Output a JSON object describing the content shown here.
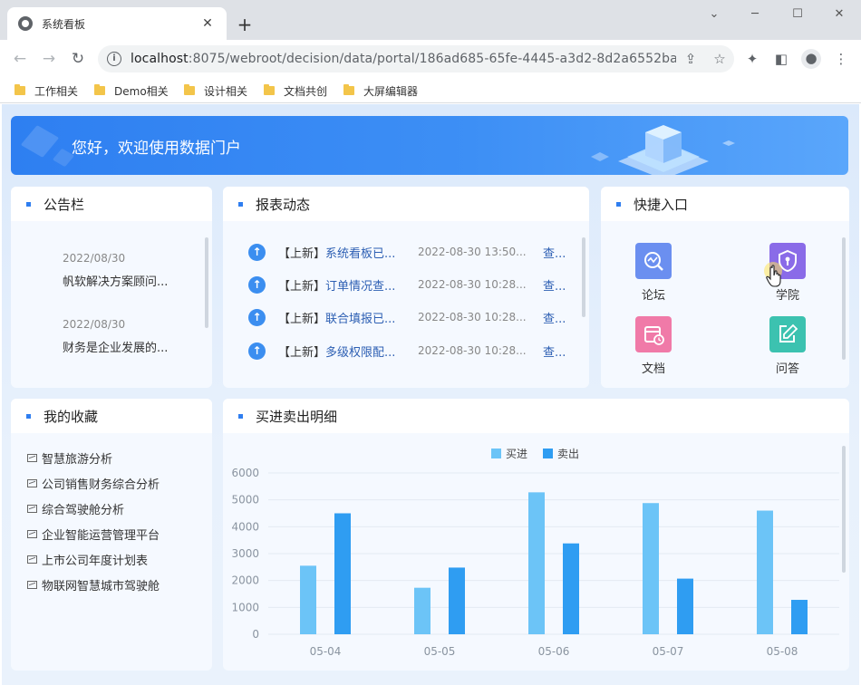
{
  "browser": {
    "tab_title": "系统看板",
    "tab_close": "✕",
    "new_tab": "+",
    "url_host": "localhost",
    "url_rest": ":8075/webroot/decision/data/portal/186ad685-65fe-4445-a3d2-8d2a6552ba2…",
    "window_controls": {
      "minimize": "─",
      "maximize": "☐",
      "close": "✕",
      "tab_search": "⌄"
    },
    "bookmarks": [
      "工作相关",
      "Demo相关",
      "设计相关",
      "文档共创",
      "大屏编辑器"
    ]
  },
  "banner": {
    "greeting": "您好，欢迎使用数据门户"
  },
  "notice": {
    "title": "公告栏",
    "items": [
      {
        "date": "2022/08/30",
        "text": "帆软解决方案顾问..."
      },
      {
        "date": "2022/08/30",
        "text": "财务是企业发展的..."
      }
    ]
  },
  "reports": {
    "title": "报表动态",
    "items": [
      {
        "tag": "【上新】",
        "name": "系统看板已...",
        "time": "2022-08-30 13:50...",
        "view": "查..."
      },
      {
        "tag": "【上新】",
        "name": "订单情况查...",
        "time": "2022-08-30 10:28...",
        "view": "查..."
      },
      {
        "tag": "【上新】",
        "name": "联合填报已...",
        "time": "2022-08-30 10:28...",
        "view": "查..."
      },
      {
        "tag": "【上新】",
        "name": "多级权限配...",
        "time": "2022-08-30 10:28...",
        "view": "查..."
      }
    ]
  },
  "quick": {
    "title": "快捷入口",
    "items": [
      {
        "label": "论坛",
        "color": "#6b8ff0",
        "icon": "chart-line-icon"
      },
      {
        "label": "学院",
        "color": "#8a6be8",
        "icon": "shield-icon"
      },
      {
        "label": "文档",
        "color": "#f07aa8",
        "icon": "calendar-icon"
      },
      {
        "label": "问答",
        "color": "#3cc2b0",
        "icon": "edit-icon"
      }
    ]
  },
  "favorites": {
    "title": "我的收藏",
    "items": [
      "智慧旅游分析",
      "公司销售财务综合分析",
      "综合驾驶舱分析",
      "企业智能运营管理平台",
      "上市公司年度计划表",
      "物联网智慧城市驾驶舱"
    ]
  },
  "trade": {
    "title": "买进卖出明细"
  },
  "chart_data": {
    "type": "bar",
    "categories": [
      "05-04",
      "05-05",
      "05-06",
      "05-07",
      "05-08"
    ],
    "series": [
      {
        "name": "买进",
        "values": [
          2550,
          1730,
          5280,
          4880,
          4600
        ],
        "color": "#6cc4f7"
      },
      {
        "name": "卖出",
        "values": [
          4500,
          2480,
          3380,
          2070,
          1280
        ],
        "color": "#2f9df2"
      }
    ],
    "ylim": [
      0,
      6000
    ],
    "yticks": [
      0,
      1000,
      2000,
      3000,
      4000,
      5000,
      6000
    ],
    "legend": "top-center",
    "grid": true
  }
}
